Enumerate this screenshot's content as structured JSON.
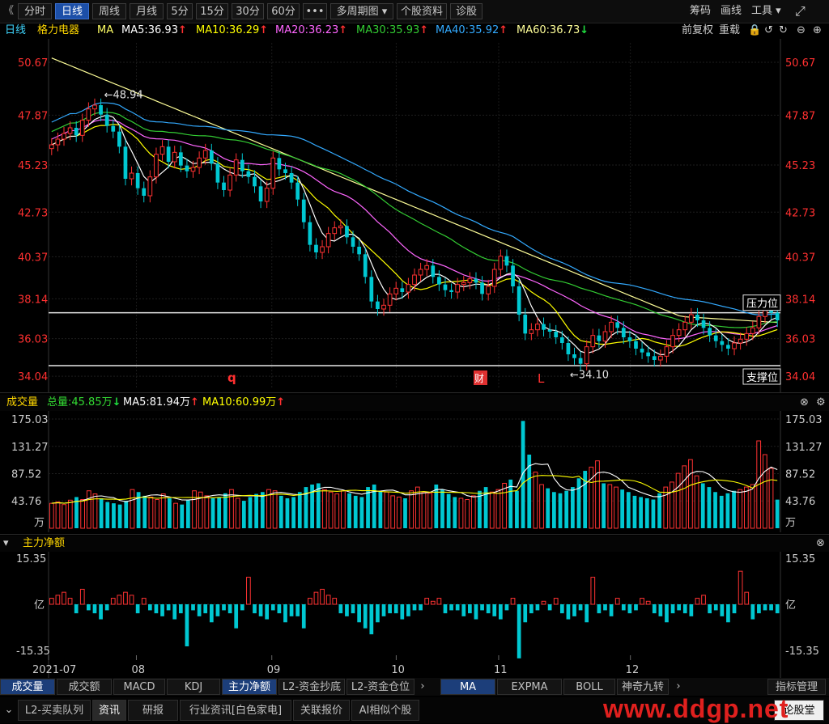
{
  "toolbar": {
    "back": "《",
    "buttons": [
      "分时",
      "日线",
      "周线",
      "月线",
      "5分",
      "15分",
      "30分",
      "60分",
      "•••",
      "多周期图 ▾",
      "个股资料",
      "诊股"
    ],
    "active_index": 1,
    "right": [
      "筹码",
      "画线",
      "工具 ▾"
    ],
    "expand_icon": "⤢"
  },
  "legend": {
    "period": "日线",
    "stock": "格力电器",
    "ma_label": "MA",
    "items": [
      {
        "text": "MA5:36.93",
        "dir": "up",
        "color": "#ffffff"
      },
      {
        "text": "MA10:36.29",
        "dir": "up",
        "color": "#ffff00"
      },
      {
        "text": "MA20:36.23",
        "dir": "up",
        "color": "#ff66ff"
      },
      {
        "text": "MA30:35.93",
        "dir": "up",
        "color": "#33cc33"
      },
      {
        "text": "MA40:35.92",
        "dir": "up",
        "color": "#33aaff"
      },
      {
        "text": "MA60:36.73",
        "dir": "down",
        "color": "#ffff99"
      }
    ],
    "right": [
      "前复权",
      "重载"
    ],
    "up_arrow": "↑",
    "down_arrow": "↓"
  },
  "volume_header": {
    "title": "成交量",
    "total": "总量:45.85万",
    "ma5": "MA5:81.94万",
    "ma10": "MA10:60.99万",
    "total_dir": "down",
    "ma_dir": "up"
  },
  "netflow_header": {
    "title": "主力净额",
    "toggle": "▾"
  },
  "x_labels": [
    "2021-07",
    "08",
    "09",
    "10",
    "11",
    "12"
  ],
  "annotations": {
    "high": "←48.94",
    "low": "←34.10",
    "resistance": "压力位",
    "support": "支撑位",
    "q_mark": "q",
    "cai_mark": "财",
    "l_mark": "L"
  },
  "indicator_tabs": [
    "成交量",
    "成交额",
    "MACD",
    "KDJ",
    "主力净额",
    "L2-资金抄底",
    "L2-资金仓位"
  ],
  "indicator_tabs_active": [
    0,
    4
  ],
  "ma_tabs": [
    "MA",
    "EXPMA",
    "BOLL",
    "神奇九转"
  ],
  "ma_tabs_active": 0,
  "indicator_manage": "指标管理",
  "footer_tabs": [
    "L2-买卖队列",
    "资讯",
    "研报",
    "行业资讯[白色家电]",
    "关联报价",
    "AI相似个股"
  ],
  "footer_active": 1,
  "footer_right": "论股堂",
  "watermark": "www.ddgp.net",
  "colors": {
    "up": "#ff3232",
    "down": "#00c8d2",
    "bg": "#000000",
    "price_axis": "#ff3030"
  },
  "chart_data": [
    {
      "type": "candlestick",
      "title": "日线 格力电器",
      "y_ticks": [
        50.67,
        47.87,
        45.23,
        42.73,
        40.37,
        38.14,
        36.03,
        34.04
      ],
      "ylim": [
        33.4,
        51.7
      ],
      "x_ticks": [
        "2021-07",
        "08",
        "09",
        "10",
        "11",
        "12"
      ],
      "high_label": 48.94,
      "low_label": 34.1,
      "resistance_level": 37.4,
      "support_level": 34.6,
      "ma": {
        "MA5": 36.93,
        "MA10": 36.29,
        "MA20": 36.23,
        "MA30": 35.93,
        "MA40": 35.92,
        "MA60": 36.73
      },
      "close_series": [
        46.3,
        46.6,
        46.9,
        47.2,
        46.8,
        47.6,
        48.2,
        48.4,
        47.9,
        47.3,
        47.0,
        46.2,
        44.5,
        44.8,
        44.0,
        43.6,
        44.6,
        45.8,
        46.2,
        45.4,
        45.9,
        45.2,
        44.9,
        45.1,
        45.6,
        46.0,
        45.3,
        44.3,
        43.9,
        44.7,
        45.5,
        44.9,
        44.6,
        44.1,
        43.3,
        44.0,
        45.6,
        45.0,
        44.8,
        44.3,
        43.4,
        42.2,
        41.0,
        40.6,
        40.9,
        41.6,
        41.9,
        42.0,
        41.4,
        40.9,
        40.5,
        39.3,
        38.0,
        37.6,
        37.8,
        38.4,
        38.7,
        38.5,
        38.9,
        39.4,
        39.7,
        39.9,
        39.3,
        38.9,
        38.6,
        38.5,
        38.9,
        39.0,
        39.2,
        39.0,
        38.4,
        38.8,
        39.7,
        40.4,
        39.9,
        38.8,
        37.3,
        36.3,
        36.5,
        36.8,
        36.5,
        36.4,
        36.1,
        35.8,
        35.2,
        35.0,
        34.7,
        35.6,
        36.2,
        35.9,
        36.4,
        36.9,
        36.6,
        36.1,
        35.9,
        35.5,
        35.3,
        35.1,
        34.9,
        35.1,
        35.6,
        36.2,
        36.5,
        36.9,
        37.3,
        37.0,
        36.6,
        36.2,
        35.9,
        35.7,
        35.5,
        35.8,
        36.0,
        36.3,
        36.6,
        37.2,
        37.6,
        37.4,
        37.0
      ],
      "open_series": [
        46.1,
        46.3,
        46.6,
        46.9,
        47.2,
        46.8,
        47.6,
        48.2,
        48.4,
        47.9,
        47.3,
        47.0,
        46.2,
        44.5,
        44.8,
        44.0,
        43.6,
        44.6,
        45.8,
        46.2,
        45.4,
        45.9,
        45.2,
        44.9,
        45.1,
        45.6,
        46.0,
        45.3,
        44.3,
        43.9,
        44.7,
        45.5,
        44.9,
        44.6,
        44.1,
        43.3,
        44.0,
        45.6,
        45.0,
        44.8,
        44.3,
        43.4,
        42.2,
        41.0,
        40.6,
        40.9,
        41.6,
        41.9,
        42.0,
        41.4,
        40.9,
        40.5,
        39.3,
        38.0,
        37.6,
        37.8,
        38.4,
        38.7,
        38.5,
        38.9,
        39.4,
        39.7,
        39.9,
        39.3,
        38.9,
        38.6,
        38.5,
        38.9,
        39.0,
        39.2,
        39.0,
        38.4,
        38.8,
        39.7,
        40.4,
        39.9,
        38.8,
        37.3,
        36.3,
        36.5,
        36.8,
        36.5,
        36.4,
        36.1,
        35.8,
        35.2,
        35.0,
        34.7,
        35.6,
        36.2,
        35.9,
        36.4,
        36.9,
        36.6,
        36.1,
        35.9,
        35.5,
        35.3,
        35.1,
        34.9,
        35.1,
        35.6,
        36.2,
        36.5,
        36.9,
        37.3,
        37.0,
        36.6,
        36.2,
        35.9,
        35.7,
        35.5,
        35.8,
        36.0,
        36.3,
        36.6,
        37.2,
        37.6,
        37.4
      ]
    },
    {
      "type": "bar",
      "title": "成交量",
      "unit": "万",
      "y_ticks": [
        175.03,
        131.27,
        87.52,
        43.76
      ],
      "ylim": [
        0,
        175.03
      ],
      "values": [
        40,
        42,
        38,
        45,
        50,
        46,
        60,
        55,
        48,
        42,
        40,
        38,
        44,
        62,
        58,
        52,
        50,
        46,
        55,
        48,
        40,
        38,
        45,
        60,
        58,
        52,
        48,
        50,
        56,
        62,
        48,
        44,
        50,
        55,
        58,
        62,
        60,
        52,
        48,
        50,
        58,
        66,
        70,
        72,
        62,
        58,
        55,
        60,
        56,
        52,
        50,
        66,
        70,
        60,
        58,
        52,
        50,
        48,
        60,
        66,
        58,
        56,
        70,
        62,
        55,
        50,
        48,
        46,
        52,
        60,
        66,
        58,
        62,
        72,
        78,
        60,
        172,
        118,
        90,
        70,
        64,
        58,
        56,
        60,
        66,
        80,
        92,
        98,
        108,
        72,
        70,
        66,
        62,
        58,
        52,
        50,
        48,
        46,
        56,
        66,
        74,
        88,
        100,
        110,
        84,
        72,
        66,
        58,
        52,
        56,
        60,
        62,
        66,
        70,
        140,
        118,
        96,
        45.85
      ]
    },
    {
      "type": "bar",
      "title": "主力净额",
      "unit": "亿",
      "y_ticks": [
        15.35,
        -15.35
      ],
      "ylim": [
        -15.35,
        15.35
      ],
      "values": [
        2,
        3,
        4,
        2,
        -3,
        5,
        -2,
        -3,
        -5,
        -2,
        2,
        3,
        4,
        3,
        -3,
        2,
        -2,
        -3,
        -4,
        -2,
        -5,
        -3,
        -14,
        -2,
        -4,
        -3,
        -6,
        -4,
        -2,
        -3,
        -8,
        -2,
        9,
        -3,
        -4,
        -5,
        -2,
        -3,
        -6,
        -4,
        -4,
        -8,
        2,
        4,
        5,
        3,
        2,
        -3,
        -4,
        -3,
        -6,
        -8,
        -10,
        -6,
        -4,
        -3,
        -3,
        -5,
        -4,
        -2,
        -2,
        2,
        1,
        2,
        -3,
        -2,
        -2,
        -4,
        -3,
        -5,
        -2,
        -3,
        -4,
        -5,
        -2,
        2,
        -18,
        -6,
        -3,
        -2,
        1,
        -2,
        2,
        -3,
        -5,
        -4,
        -2,
        -6,
        9,
        -3,
        -2,
        -4,
        2,
        -2,
        -3,
        -2,
        2,
        1,
        -3,
        -4,
        -6,
        -3,
        -2,
        -3,
        -4,
        2,
        3,
        -3,
        -2,
        -4,
        -6,
        -3,
        11,
        4,
        -5,
        -3,
        -2,
        -2,
        -3
      ]
    }
  ]
}
